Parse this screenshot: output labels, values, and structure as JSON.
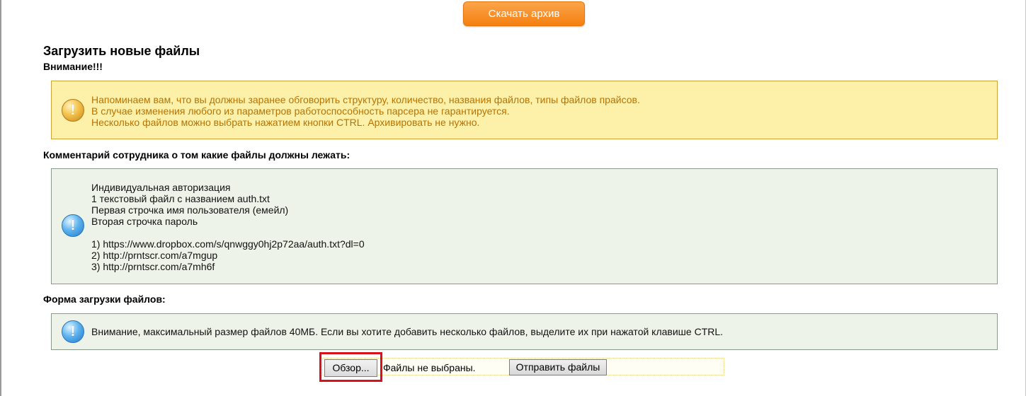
{
  "download_button": {
    "label": "Скачать архив"
  },
  "page": {
    "title": "Загрузить новые файлы",
    "attention": "Внимание!!!"
  },
  "warning_box": {
    "icon": "warning-icon",
    "lines": [
      "Напоминаем вам, что вы должны заранее обговорить структуру, количество, названия файлов, типы файлов прайсов.",
      "В случае изменения любого из параметров работоспособность парсера не гарантируется.",
      "Несколько файлов можно выбрать нажатием кнопки CTRL. Архивировать не нужно."
    ]
  },
  "comment_section": {
    "heading": "Комментарий сотрудника о том какие файлы должны лежать:",
    "icon": "info-icon",
    "lines": [
      "Индивидуальная авторизация",
      "1 текстовый файл с названием auth.txt",
      "Первая строчка имя пользователя (емейл)",
      "Вторая строчка пароль",
      "",
      "1) https://www.dropbox.com/s/qnwggy0hj2p72aa/auth.txt?dl=0",
      "2) http://prntscr.com/a7mgup",
      "3) http://prntscr.com/a7mh6f"
    ]
  },
  "upload_section": {
    "heading": "Форма загрузки файлов:",
    "note_icon": "info-icon",
    "note": "Внимание, максимальный размер файлов 40МБ. Если вы хотите добавить несколько файлов, выделите их при нажатой клавише CTRL.",
    "browse_label": "Обзор...",
    "no_files_text": "Файлы не выбраны.",
    "submit_label": "Отправить файлы"
  },
  "colors": {
    "accent_orange": "#f5891f",
    "warning_bg": "#fdf0a8",
    "warning_text": "#b87300",
    "info_bg": "#eef3ea",
    "highlight_red": "#d9111b"
  }
}
